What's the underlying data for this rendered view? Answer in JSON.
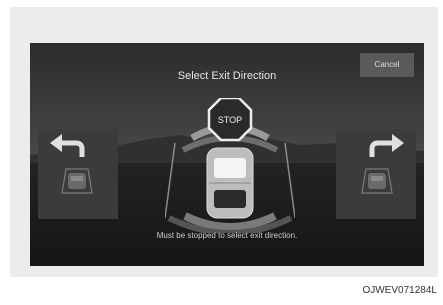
{
  "screen": {
    "title": "Select Exit Direction",
    "cancel_label": "Cancel",
    "stop_sign_text": "STOP",
    "message": "Must be stopped to select exit direction."
  },
  "caption": "OJWEV071284L",
  "icons": {
    "left_exit": "left-turn-arrow-car-icon",
    "right_exit": "right-turn-arrow-car-icon",
    "stop": "stop-sign-icon",
    "vehicle": "vehicle-top-view-icon",
    "sensors": "parking-sensor-arcs-icon"
  },
  "colors": {
    "screen_bg": "#1d1d1d",
    "panel_bg": "#3b3b3b",
    "text": "#e6e6e6",
    "arrow": "#e0e0e0"
  }
}
